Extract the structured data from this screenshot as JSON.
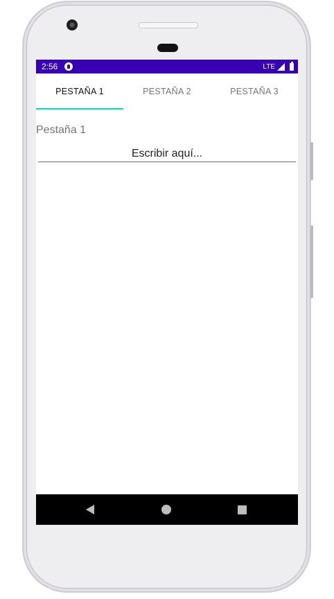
{
  "status_bar": {
    "time": "2:56",
    "network": "LTE",
    "background_color": "#3700b3"
  },
  "tabs": [
    {
      "label": "PESTAÑA 1",
      "selected": true
    },
    {
      "label": "PESTAÑA 2",
      "selected": false
    },
    {
      "label": "PESTAÑA 3",
      "selected": false
    }
  ],
  "tab_indicator_color": "#03dac5",
  "content": {
    "page_label": "Pestaña 1",
    "text_field": {
      "placeholder": "Escribir aquí..."
    }
  },
  "navigation_bar": {
    "back_icon": "back-triangle",
    "home_icon": "home-circle",
    "recents_icon": "recents-square"
  }
}
